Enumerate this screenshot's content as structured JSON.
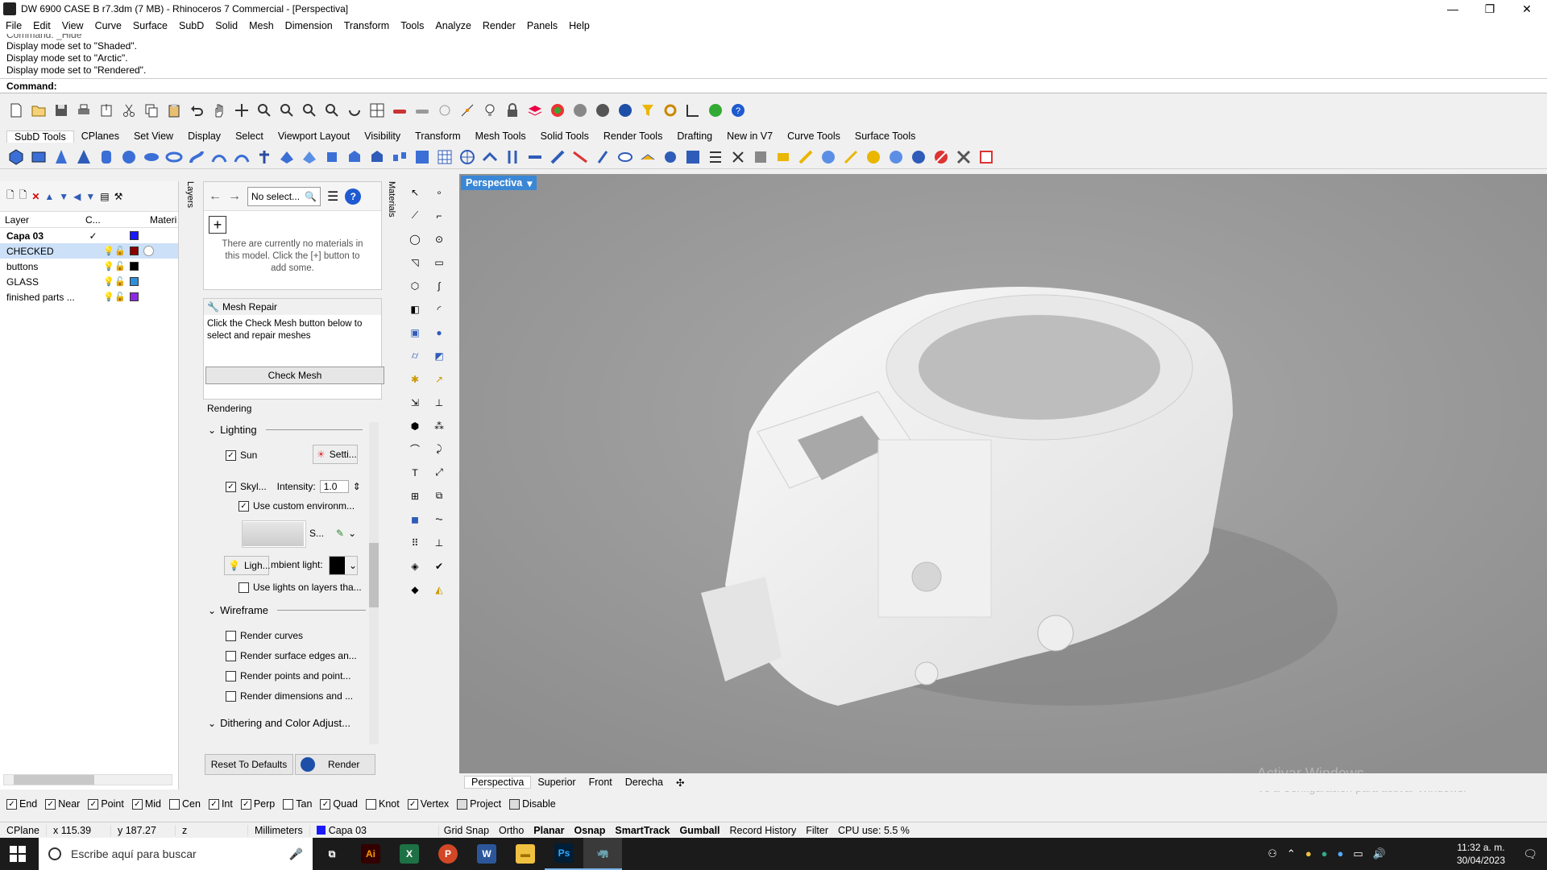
{
  "window": {
    "title": "DW 6900 CASE B r7.3dm (7 MB) - Rhinoceros 7 Commercial - [Perspectiva]",
    "min": "—",
    "max": "❐",
    "close": "✕"
  },
  "menu": [
    "File",
    "Edit",
    "View",
    "Curve",
    "Surface",
    "SubD",
    "Solid",
    "Mesh",
    "Dimension",
    "Transform",
    "Tools",
    "Analyze",
    "Render",
    "Panels",
    "Help"
  ],
  "command_history": [
    "Command: _Hide",
    "Display mode set to \"Shaded\".",
    "Display mode set to \"Arctic\".",
    "Display mode set to \"Rendered\"."
  ],
  "command_prompt": "Command:",
  "toolbar_tabs": [
    "SubD Tools",
    "CPlanes",
    "Set View",
    "Display",
    "Select",
    "Viewport Layout",
    "Visibility",
    "Transform",
    "Mesh Tools",
    "Solid Tools",
    "Render Tools",
    "Drafting",
    "New in V7",
    "Curve Tools",
    "Surface Tools"
  ],
  "layers": {
    "headers": {
      "layer": "Layer",
      "current": "C...",
      "material": "Materi"
    },
    "vertical_tab": "Layers",
    "rows": [
      {
        "name": "Capa 03",
        "current": "✓",
        "color": "#1a1aff",
        "bold": true
      },
      {
        "name": "CHECKED",
        "current": "",
        "color": "#8b0000",
        "selected": true
      },
      {
        "name": "buttons",
        "current": "",
        "color": "#000000"
      },
      {
        "name": "GLASS",
        "current": "",
        "color": "#2f8fd8"
      },
      {
        "name": "finished parts ...",
        "current": "",
        "color": "#8a2be2"
      }
    ]
  },
  "materials": {
    "vertical_tab": "Materials",
    "filter": "No select...",
    "add": "+",
    "empty_message": "There are currently no materials in this model. Click the [+] button to add some."
  },
  "mesh_repair": {
    "title": "Mesh Repair",
    "text": "Click the Check Mesh button below to select and repair meshes",
    "button": "Check Mesh"
  },
  "rendering": {
    "title": "Rendering",
    "lighting": "Lighting",
    "sun": "Sun",
    "sun_settings": "Setti...",
    "skylight": "Skyl...",
    "intensity_label": "Intensity:",
    "intensity": "1.0",
    "custom_env": "Use custom environm...",
    "env_s": "S...",
    "lights_label": "Ligh...",
    "ambient": "mbient light:",
    "lights_on_layers": "Use lights on layers tha...",
    "wireframe": "Wireframe",
    "render_curves": "Render curves",
    "render_surface_edges": "Render surface edges an...",
    "render_points": "Render points and point...",
    "render_dims": "Render dimensions and ...",
    "dithering": "Dithering and Color Adjust...",
    "reset": "Reset To Defaults",
    "render_btn": "Render"
  },
  "viewport": {
    "label": "Perspectiva",
    "tabs": [
      "Perspectiva",
      "Superior",
      "Front",
      "Derecha"
    ],
    "watermark_title": "Activar Windows",
    "watermark_text": "Ve a Configuración para activar Windows."
  },
  "osnaps": [
    {
      "label": "End",
      "checked": true
    },
    {
      "label": "Near",
      "checked": true
    },
    {
      "label": "Point",
      "checked": true
    },
    {
      "label": "Mid",
      "checked": true
    },
    {
      "label": "Cen",
      "checked": false
    },
    {
      "label": "Int",
      "checked": true
    },
    {
      "label": "Perp",
      "checked": true
    },
    {
      "label": "Tan",
      "checked": false
    },
    {
      "label": "Quad",
      "checked": true
    },
    {
      "label": "Knot",
      "checked": false
    },
    {
      "label": "Vertex",
      "checked": true
    },
    {
      "label": "Project",
      "checked": false
    },
    {
      "label": "Disable",
      "checked": false
    }
  ],
  "status": {
    "cplane": "CPlane",
    "x": "x 115.39",
    "y": "y 187.27",
    "z": "z",
    "units": "Millimeters",
    "layer": "Capa 03",
    "layer_color": "#1a1aff",
    "grid_snap": "Grid Snap",
    "ortho": "Ortho",
    "planar": "Planar",
    "osnap": "Osnap",
    "smarttrack": "SmartTrack",
    "gumball": "Gumball",
    "record_history": "Record History",
    "filter": "Filter",
    "cpu": "CPU use: 5.5 %"
  },
  "taskbar": {
    "search_placeholder": "Escribe aquí para buscar",
    "apps": [
      {
        "name": "task-view",
        "label": "⧉",
        "color": "#1b1b1b"
      },
      {
        "name": "illustrator",
        "label": "Ai",
        "color": "#330000"
      },
      {
        "name": "excel",
        "label": "X",
        "color": "#1e7145"
      },
      {
        "name": "powerpoint",
        "label": "P",
        "color": "#d24726"
      },
      {
        "name": "word",
        "label": "W",
        "color": "#2b579a"
      },
      {
        "name": "file-explorer",
        "label": "▬",
        "color": "#f0c040"
      },
      {
        "name": "photoshop",
        "label": "Ps",
        "color": "#001e36"
      },
      {
        "name": "rhino",
        "label": "🦏",
        "color": "#444444"
      }
    ],
    "time": "11:32 a. m.",
    "date": "30/04/2023"
  }
}
